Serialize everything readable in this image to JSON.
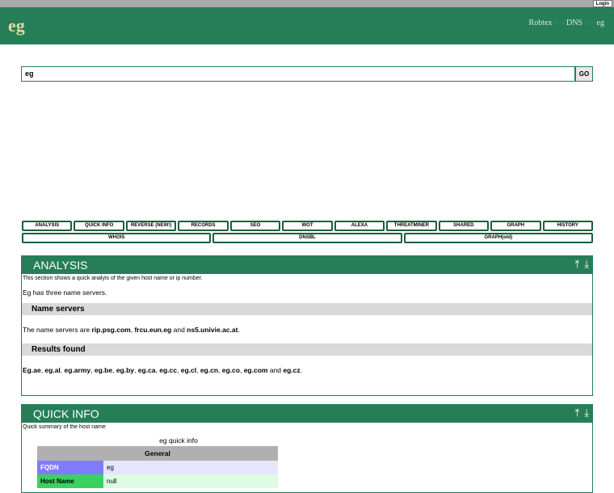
{
  "topbar": {
    "login_label": "Login"
  },
  "header": {
    "brand": "eg",
    "breadcrumb": {
      "items": [
        "Robtex",
        "DNS",
        "eg"
      ],
      "separator": ">>>"
    }
  },
  "search": {
    "value": "eg",
    "go_label": "GO"
  },
  "tabs": {
    "row1": [
      "ANALYSIS",
      "QUICK INFO",
      "REVERSE (NEW!)",
      "RECORDS",
      "SEO",
      "WOT",
      "ALEXA",
      "THREATMINER",
      "SHARED",
      "GRAPH",
      "HISTORY"
    ],
    "row2": [
      "WHOIS",
      "DNSBL",
      "GRAPH(old)"
    ]
  },
  "analysis": {
    "title": "ANALYSIS",
    "description": "This section shows a quick analyis of the given host name or ip number.",
    "summary": "Eg has three name servers.",
    "name_servers_heading": "Name servers",
    "ns_prefix": "The name servers are ",
    "ns": [
      "rip.psg.com",
      "frcu.eun.eg",
      "ns5.univie.ac.at"
    ],
    "ns_sep1": ", ",
    "ns_sep2": " and ",
    "ns_suffix": ".",
    "results_heading": "Results found",
    "results": [
      "Eg.ae",
      "eg.al",
      "eg.army",
      "eg.be",
      "eg.by",
      "eg.ca",
      "eg.cc",
      "eg.cl",
      "eg.cn",
      "eg.co",
      "eg.com",
      "eg.cz"
    ],
    "results_and": " and ",
    "results_suffix": "."
  },
  "quickinfo": {
    "title": "QUICK INFO",
    "description": "Quick summary of the host name",
    "table_title": "eg quick info",
    "section": "General",
    "rows": [
      {
        "key": "FQDN",
        "value": "eg"
      },
      {
        "key": "Host Name",
        "value": "null"
      }
    ]
  },
  "colors": {
    "brand_green": "#267e58",
    "fqdn_key": "#7f7cff",
    "hostname_key": "#3bd15f"
  },
  "icons": [
    "to-top-icon",
    "to-bottom-icon"
  ]
}
